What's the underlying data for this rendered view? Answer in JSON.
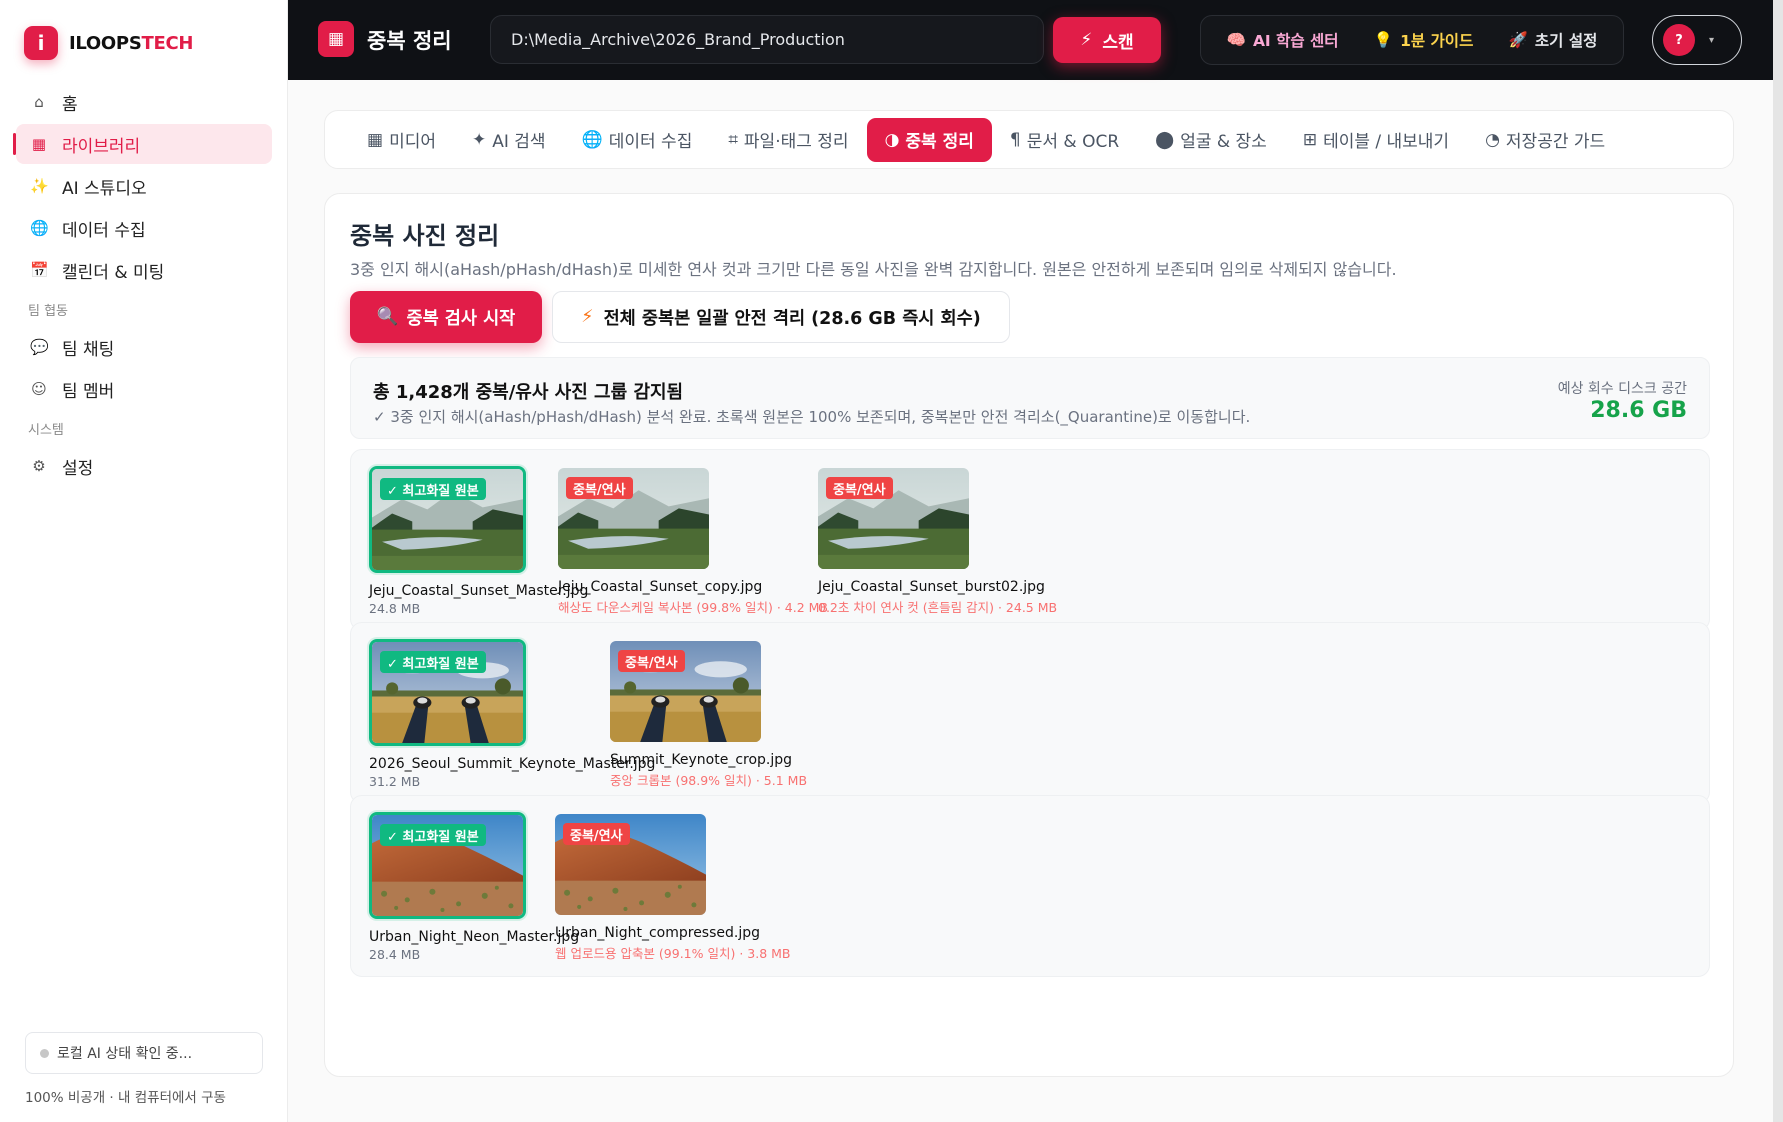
{
  "brand": {
    "logo_letter": "i",
    "name_main": "ILOOPS",
    "name_accent": "TECH"
  },
  "sidebar": {
    "items": [
      {
        "label": "홈",
        "icon": "⌂"
      },
      {
        "label": "라이브러리",
        "icon": "▦"
      },
      {
        "label": "AI 스튜디오",
        "icon": "✨"
      },
      {
        "label": "데이터 수집",
        "icon": "🌐"
      },
      {
        "label": "캘린더 & 미팅",
        "icon": "📅"
      }
    ],
    "section_team": "팀 협동",
    "team_items": [
      {
        "label": "팀 채팅",
        "icon": "💬"
      },
      {
        "label": "팀 멤버",
        "icon": "☺"
      }
    ],
    "section_system": "시스템",
    "system_items": [
      {
        "label": "설정",
        "icon": "⚙"
      }
    ],
    "status_text": "로컬 AI 상태 확인 중...",
    "privacy_text": "100% 비공개 · 내 컴퓨터에서 구동"
  },
  "topbar": {
    "title_icon": "▦",
    "title": "중복 정리",
    "path_value": "D:\\Media_Archive\\2026_Brand_Production",
    "scan_icon": "⚡",
    "scan_label": "스캔",
    "group": [
      {
        "icon": "🧠",
        "label": "AI 학습 센터"
      },
      {
        "icon": "💡",
        "label": "1분 가이드"
      },
      {
        "icon": "🚀",
        "label": "초기 설정"
      }
    ],
    "help_label": "?",
    "help_caret": "▾"
  },
  "tabs": [
    {
      "icon": "▦",
      "label": "미디어"
    },
    {
      "icon": "✦",
      "label": "AI 검색"
    },
    {
      "icon": "🌐",
      "label": "데이터 수집"
    },
    {
      "icon": "⌗",
      "label": "파일·태그 정리"
    },
    {
      "icon": "◑",
      "label": "중복 정리"
    },
    {
      "icon": "¶",
      "label": "문서 & OCR"
    },
    {
      "icon": "⬤",
      "label": "얼굴 & 장소"
    },
    {
      "icon": "⊞",
      "label": "테이블 / 내보내기"
    },
    {
      "icon": "◔",
      "label": "저장공간 가드"
    }
  ],
  "card": {
    "title": "중복 사진 정리",
    "description": "3중 인지 해시(aHash/pHash/dHash)로 미세한 연사 컷과 크기만 다른 동일 사진을 완벽 감지합니다. 원본은 안전하게 보존되며 임의로 삭제되지 않습니다.",
    "primary_icon": "🔍",
    "primary_label": "중복 검사 시작",
    "secondary_icon": "⚡",
    "secondary_label": "전체 중복본 일괄 안전 격리 (28.6 GB 즉시 회수)",
    "summary_title": "총 1,428개 중복/유사 사진 그룹 감지됨",
    "summary_desc": "✓ 3중 인지 해시(aHash/pHash/dHash) 분석 완료. 초록색 원본은 100% 보존되며, 중복본만 안전 격리소(_Quarantine)로 이동합니다.",
    "summary_label": "예상 회수 디스크 공간",
    "summary_value": "28.6 GB"
  },
  "badges": {
    "master": "✓ 최고화질 원본",
    "dup": "중복/연사"
  },
  "groups": [
    {
      "scene": "lake",
      "items": [
        {
          "type": "master",
          "name": "Jeju_Coastal_Sunset_Master.jpg",
          "meta": "24.8 MB"
        },
        {
          "type": "dup",
          "name": "Jeju_Coastal_Sunset_copy.jpg",
          "meta": "해상도 다운스케일 복사본 (99.8% 일치) · 4.2 MB"
        },
        {
          "type": "dup",
          "name": "Jeju_Coastal_Sunset_burst02.jpg",
          "meta": "0.2초 차이 연사 컷 (흔들림 감지) · 24.5 MB"
        }
      ]
    },
    {
      "scene": "field",
      "items": [
        {
          "type": "master",
          "name": "2026_Seoul_Summit_Keynote_Master.jpg",
          "meta": "31.2 MB"
        },
        {
          "type": "dup",
          "name": "Summit_Keynote_crop.jpg",
          "meta": "중앙 크롭본 (98.9% 일치) · 5.1 MB"
        }
      ]
    },
    {
      "scene": "desert",
      "items": [
        {
          "type": "master",
          "name": "Urban_Night_Neon_Master.jpg",
          "meta": "28.4 MB"
        },
        {
          "type": "dup",
          "name": "Urban_Night_compressed.jpg",
          "meta": "웹 업로드용 압축본 (99.1% 일치) · 3.8 MB"
        }
      ]
    }
  ],
  "colors": {
    "accent": "#e11d48",
    "master": "#10b981",
    "dup": "#ef4444",
    "saved": "#16a34a"
  }
}
